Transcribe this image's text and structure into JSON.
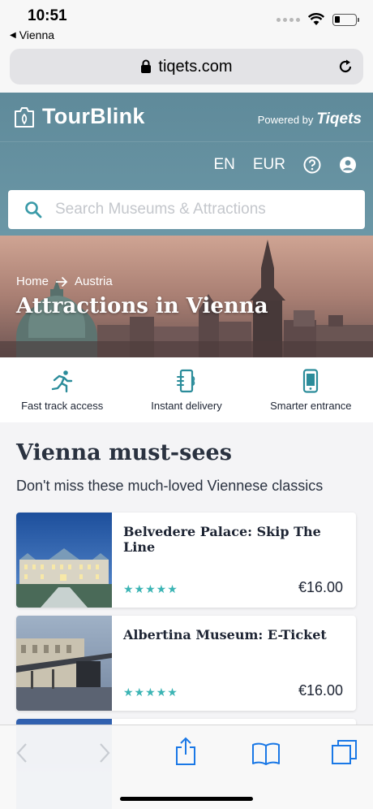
{
  "status": {
    "time": "10:51",
    "back_label": "Vienna"
  },
  "browser": {
    "url": "tiqets.com"
  },
  "header": {
    "brand": "TourBlink",
    "powered_prefix": "Powered by",
    "powered_brand": "Tiqets",
    "language": "EN",
    "currency": "EUR"
  },
  "search": {
    "placeholder": "Search Museums & Attractions"
  },
  "hero": {
    "breadcrumb": [
      "Home",
      "Austria"
    ],
    "title": "Attractions in Vienna"
  },
  "features": [
    {
      "label": "Fast track access",
      "icon": "running-person-icon"
    },
    {
      "label": "Instant delivery",
      "icon": "phone-ticket-icon"
    },
    {
      "label": "Smarter entrance",
      "icon": "smartphone-icon"
    }
  ],
  "section": {
    "title": "Vienna must-sees",
    "subtitle": "Don't miss these much-loved Viennese classics"
  },
  "cards": [
    {
      "title": "Belvedere Palace: Skip The Line",
      "rating": 5,
      "price": "€16.00"
    },
    {
      "title": "Albertina Museum: E-Ticket",
      "rating": 5,
      "price": "€16.00"
    }
  ],
  "colors": {
    "header_bg": "#6590a0",
    "accent": "#3bb4b4",
    "text_dark": "#1d2433"
  }
}
